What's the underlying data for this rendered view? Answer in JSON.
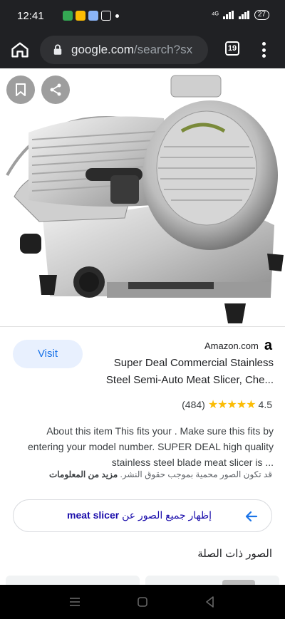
{
  "status": {
    "time": "12:41",
    "network": "⁴ᴳ",
    "battery": "27"
  },
  "browser": {
    "url_domain": "google.com",
    "url_path": "/search?sx",
    "tab_count": "19"
  },
  "result": {
    "source": "Amazon.com",
    "source_logo": "a",
    "visit_label": "Visit",
    "title_line1": "Super Deal Commercial Stainless",
    "title_line2": "Steel Semi-Auto Meat Slicer, Che...",
    "review_count": "(484)",
    "stars": "★★★★★",
    "rating": "4.5",
    "description": "About this item This fits your . Make sure this fits by entering your model number. SUPER DEAL high quality stainless steel blade meat slicer is ...",
    "copyright_text": "قد تكون الصور محمية بموجب حقوق النشر.",
    "copyright_link": "مزيد من المعلومات",
    "more_text_prefix": "إظهار جميع الصور عن",
    "more_query": "meat slicer",
    "related_title": "الصور ذات الصلة"
  },
  "colors": {
    "accent": "#1a73e8",
    "star": "#fbbc04",
    "chrome_bg": "#202124"
  }
}
